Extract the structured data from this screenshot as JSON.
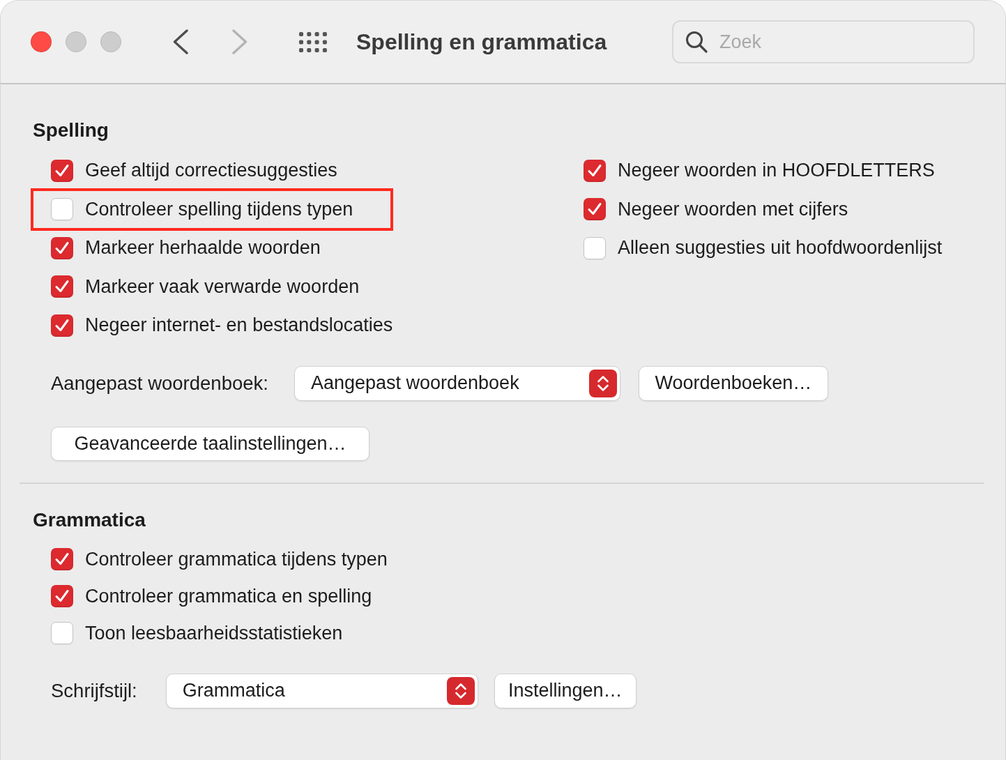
{
  "window": {
    "title": "Spelling en grammatica",
    "controls": [
      {
        "kind": "close",
        "disabled": false
      },
      {
        "kind": "minimize",
        "disabled": true
      },
      {
        "kind": "zoom",
        "disabled": true
      }
    ],
    "navigation": [
      {
        "kind": "back",
        "disabled": false
      },
      {
        "kind": "forward",
        "disabled": true
      }
    ]
  },
  "search": {
    "placeholder": "Zoek"
  },
  "spelling": {
    "heading": "Spelling",
    "options_left": [
      {
        "label": "Geef altijd correctiesuggesties",
        "checked": true,
        "highlighted": false
      },
      {
        "label": "Controleer spelling tijdens typen",
        "checked": false,
        "highlighted": true
      },
      {
        "label": "Markeer herhaalde woorden",
        "checked": true,
        "highlighted": false
      },
      {
        "label": "Markeer vaak verwarde woorden",
        "checked": true,
        "highlighted": false
      },
      {
        "label": "Negeer internet- en bestandslocaties",
        "checked": true,
        "highlighted": false
      }
    ],
    "options_right": [
      {
        "label": "Negeer woorden in HOOFDLETTERS",
        "checked": true,
        "highlighted": false
      },
      {
        "label": "Negeer woorden met cijfers",
        "checked": true,
        "highlighted": false
      },
      {
        "label": "Alleen suggesties uit hoofdwoordenlijst",
        "checked": false,
        "highlighted": false
      }
    ],
    "dictionary": {
      "label": "Aangepast woordenboek:",
      "value": "Aangepast woordenboek",
      "button": "Woordenboeken…"
    },
    "advanced_button": "Geavanceerde taalinstellingen…"
  },
  "grammar": {
    "heading": "Grammatica",
    "options": [
      {
        "label": "Controleer grammatica tijdens typen",
        "checked": true,
        "highlighted": false
      },
      {
        "label": "Controleer grammatica en spelling",
        "checked": true,
        "highlighted": false
      },
      {
        "label": "Toon leesbaarheidsstatistieken",
        "checked": false,
        "highlighted": false
      }
    ],
    "writing_style": {
      "label": "Schrijfstijl:",
      "value": "Grammatica",
      "button": "Instellingen…"
    }
  }
}
